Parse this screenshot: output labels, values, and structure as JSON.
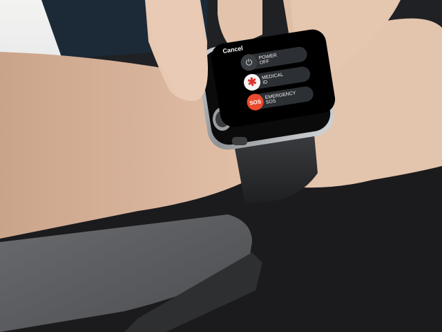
{
  "watch": {
    "cancel_label": "Cancel",
    "options": [
      {
        "label": "POWER\nOFF",
        "icon": "power-icon"
      },
      {
        "label": "MEDICAL\nID",
        "icon": "medical-asterisk-icon"
      },
      {
        "label": "EMERGENCY\nSOS",
        "icon": "sos-icon",
        "icon_text": "SOS"
      }
    ]
  },
  "colors": {
    "sos_red": "#ea4a2f",
    "medical_red": "#e0342e",
    "pill_bg": "#2c2f33"
  }
}
